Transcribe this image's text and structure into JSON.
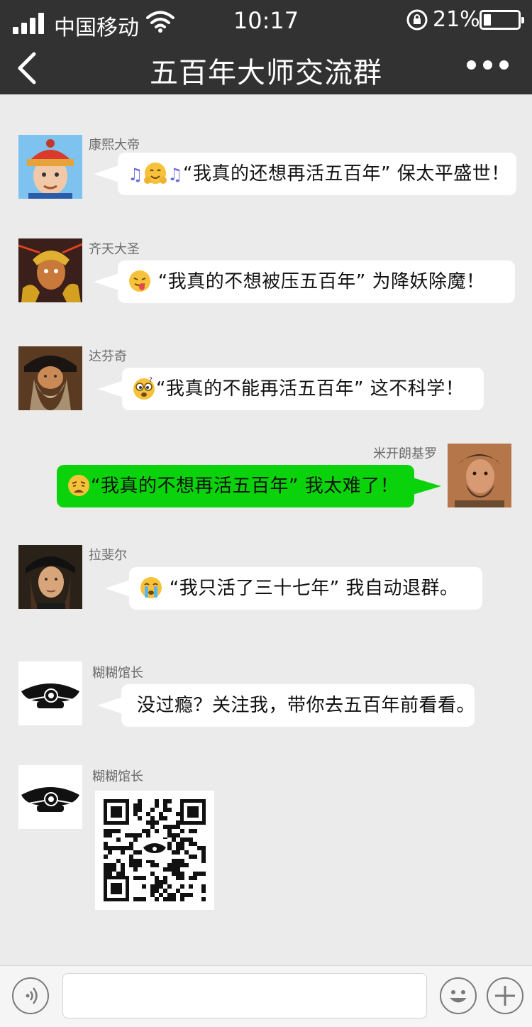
{
  "status": {
    "carrier": "中国移动",
    "time": "10:17",
    "battery": "21%",
    "battery_level": 0.21
  },
  "header": {
    "title": "五百年大师交流群"
  },
  "messages": [
    {
      "sender": "康熙大帝",
      "text": "“我真的还想再活五百年” 保太平盛世！",
      "emoji": "hugging-face"
    },
    {
      "sender": "齐天大圣",
      "text": "“我真的不想被压五百年” 为降妖除魔！",
      "emoji": "tongue-face"
    },
    {
      "sender": "达芬奇",
      "text": "“我真的不能再活五百年” 这不科学！",
      "emoji": "confused-face"
    },
    {
      "sender": "米开朗基罗",
      "text": "“我真的不想再活五百年” 我太难了！",
      "emoji": "weary-face"
    },
    {
      "sender": "拉斐尔",
      "text": "“我只活了三十七年” 我自动退群。",
      "emoji": "crying-face"
    },
    {
      "sender": "糊糊馆长",
      "text": "没过瘾？关注我，带你去五百年前看看。"
    },
    {
      "sender": "糊糊馆长"
    }
  ],
  "icons": {
    "back": "chevron-left-icon",
    "more": "more-dots-icon",
    "voice": "voice-icon",
    "emoji": "smiley-icon",
    "plus": "plus-icon"
  },
  "colors": {
    "topbar": "#323232",
    "chat_bg": "#ebebeb",
    "self_bubble": "#0bd30b",
    "other_bubble": "#ffffff"
  }
}
